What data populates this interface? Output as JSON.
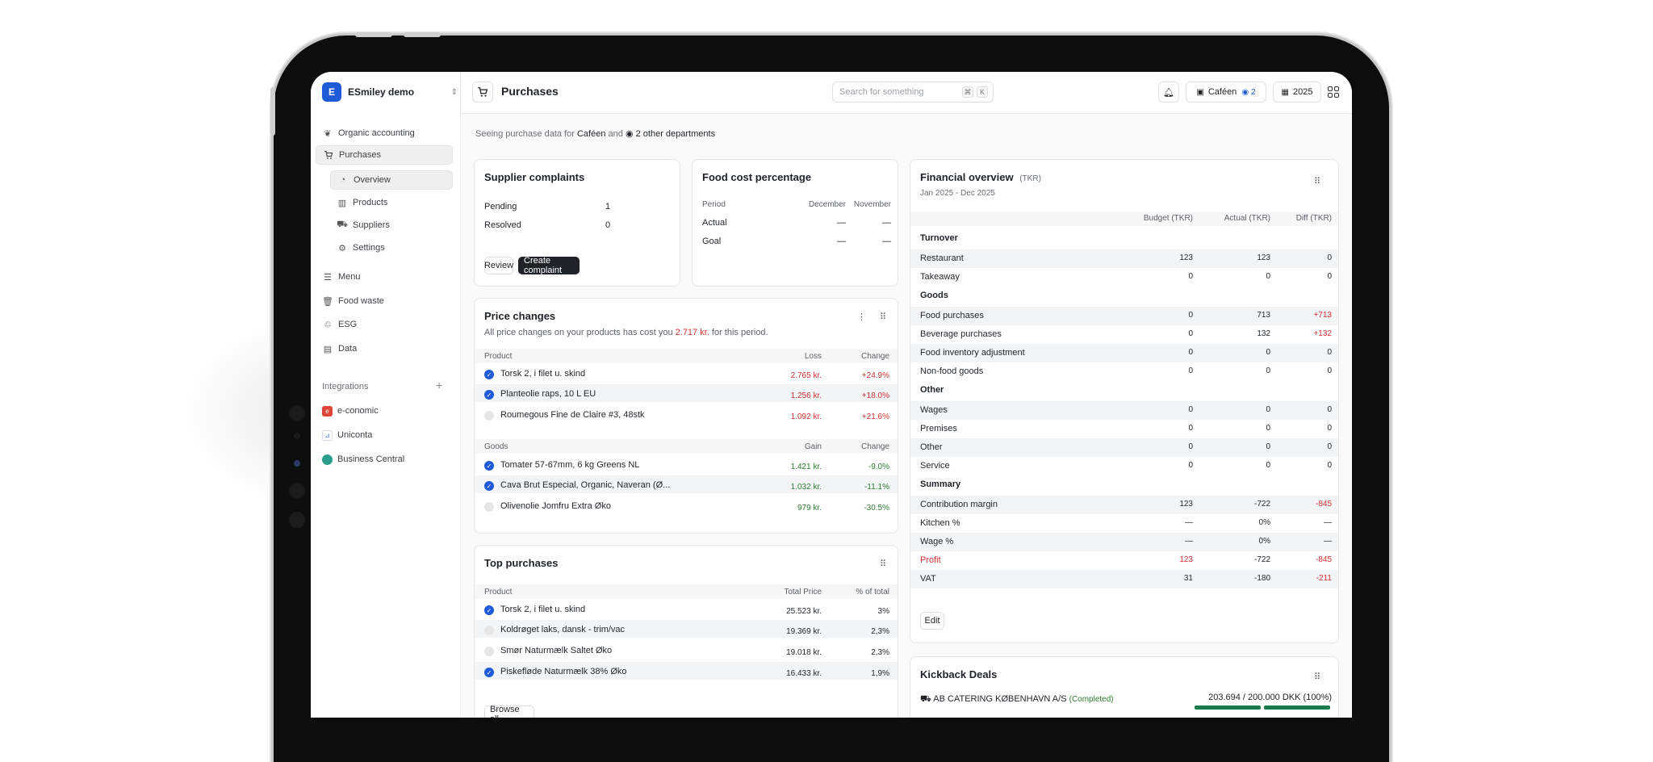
{
  "sidebar": {
    "org_initial": "E",
    "org_name": "ESmiley demo",
    "items": [
      {
        "label": "Organic accounting",
        "icon": "leaf-icon"
      },
      {
        "label": "Purchases",
        "icon": "cart-icon"
      },
      {
        "label": "Overview",
        "icon": "pie-icon"
      },
      {
        "label": "Products",
        "icon": "barcode-icon"
      },
      {
        "label": "Suppliers",
        "icon": "truck-icon"
      },
      {
        "label": "Settings",
        "icon": "gear-icon"
      },
      {
        "label": "Menu",
        "icon": "menu-icon"
      },
      {
        "label": "Food waste",
        "icon": "trash-icon"
      },
      {
        "label": "ESG",
        "icon": "recycle-icon"
      },
      {
        "label": "Data",
        "icon": "document-icon"
      }
    ],
    "integrations_label": "Integrations",
    "integrations": [
      {
        "label": "e-conomic",
        "color": "#e0453a"
      },
      {
        "label": "Uniconta",
        "color": "#3a7bd5"
      },
      {
        "label": "Business Central",
        "color": "#2a9d8f"
      }
    ]
  },
  "topbar": {
    "title": "Purchases",
    "search_placeholder": "Search for something",
    "kbd1": "⌘",
    "kbd2": "K",
    "department": "Caféen",
    "department_count": "2",
    "year": "2025"
  },
  "seeing": {
    "prefix": "Seeing purchase data for",
    "dept": "Caféen",
    "and": "and",
    "others": "2 other departments"
  },
  "complaints": {
    "title": "Supplier complaints",
    "rows": [
      {
        "label": "Pending",
        "value": "1"
      },
      {
        "label": "Resolved",
        "value": "0"
      }
    ],
    "review_label": "Review",
    "create_label": "Create complaint"
  },
  "foodcost": {
    "title": "Food cost percentage",
    "headers": [
      "Period",
      "December",
      "November"
    ],
    "rows": [
      {
        "label": "Actual",
        "dec": "—",
        "nov": "—"
      },
      {
        "label": "Goal",
        "dec": "—",
        "nov": "—"
      }
    ]
  },
  "price_changes": {
    "title": "Price changes",
    "desc_prefix": "All price changes on your products has cost you",
    "desc_amount": "2.717 kr.",
    "desc_suffix": "for this period.",
    "loss_headers": [
      "Product",
      "Loss",
      "Change"
    ],
    "loss_rows": [
      {
        "name": "Torsk 2, i filet u. skind",
        "value": "2.765 kr.",
        "change": "+24.9%",
        "checked": true
      },
      {
        "name": "Planteolie raps, 10 L EU",
        "value": "1.256 kr.",
        "change": "+18.0%",
        "checked": true
      },
      {
        "name": "Roumegous Fine de Claire #3, 48stk",
        "value": "1.092 kr.",
        "change": "+21.6%",
        "checked": false
      }
    ],
    "gain_headers": [
      "Goods",
      "Gain",
      "Change"
    ],
    "gain_rows": [
      {
        "name": "Tomater 57-67mm, 6 kg Greens NL",
        "value": "1.421 kr.",
        "change": "-9.0%",
        "checked": true
      },
      {
        "name": "Cava Brut Especial, Organic, Naveran (Ø...",
        "value": "1.032 kr.",
        "change": "-11.1%",
        "checked": true
      },
      {
        "name": "Olivenolie Jomfru Extra Øko",
        "value": "979 kr.",
        "change": "-30.5%",
        "checked": false
      }
    ]
  },
  "top_purchases": {
    "title": "Top purchases",
    "headers": [
      "Product",
      "Total Price",
      "% of total"
    ],
    "rows": [
      {
        "name": "Torsk 2, i filet u. skind",
        "price": "25.523 kr.",
        "pct": "3%",
        "checked": true
      },
      {
        "name": "Koldrøget laks, dansk - trim/vac",
        "price": "19.369 kr.",
        "pct": "2,3%",
        "checked": false
      },
      {
        "name": "Smør Naturmælk Saltet Øko",
        "price": "19.018 kr.",
        "pct": "2,3%",
        "checked": false
      },
      {
        "name": "Piskefløde Naturmælk 38% Øko",
        "price": "16.433 kr.",
        "pct": "1,9%",
        "checked": true
      }
    ],
    "browse_label": "Browse all"
  },
  "financial": {
    "title": "Financial overview",
    "unit": "(TKR)",
    "period": "Jan 2025 - Dec 2025",
    "headers": [
      "Budget (TKR)",
      "Actual (TKR)",
      "Diff (TKR)"
    ],
    "sections": [
      {
        "name": "Turnover",
        "rows": [
          {
            "label": "Restaurant",
            "budget": "123",
            "actual": "123",
            "diff": "0"
          },
          {
            "label": "Takeaway",
            "budget": "0",
            "actual": "0",
            "diff": "0"
          }
        ]
      },
      {
        "name": "Goods",
        "rows": [
          {
            "label": "Food purchases",
            "budget": "0",
            "actual": "713",
            "diff": "+713"
          },
          {
            "label": "Beverage purchases",
            "budget": "0",
            "actual": "132",
            "diff": "+132"
          },
          {
            "label": "Food inventory adjustment",
            "budget": "0",
            "actual": "0",
            "diff": "0"
          },
          {
            "label": "Non-food goods",
            "budget": "0",
            "actual": "0",
            "diff": "0"
          }
        ]
      },
      {
        "name": "Other",
        "rows": [
          {
            "label": "Wages",
            "budget": "0",
            "actual": "0",
            "diff": "0"
          },
          {
            "label": "Premises",
            "budget": "0",
            "actual": "0",
            "diff": "0"
          },
          {
            "label": "Other",
            "budget": "0",
            "actual": "0",
            "diff": "0"
          },
          {
            "label": "Service",
            "budget": "0",
            "actual": "0",
            "diff": "0"
          }
        ]
      },
      {
        "name": "Summary",
        "rows": [
          {
            "label": "Contribution margin",
            "budget": "123",
            "actual": "-722",
            "diff": "-845"
          },
          {
            "label": "Kitchen %",
            "budget": "—",
            "actual": "0%",
            "diff": "—"
          },
          {
            "label": "Wage %",
            "budget": "—",
            "actual": "0%",
            "diff": "—"
          },
          {
            "label": "Profit",
            "budget": "123",
            "actual": "-722",
            "diff": "-845"
          },
          {
            "label": "VAT",
            "budget": "31",
            "actual": "-180",
            "diff": "-211"
          }
        ]
      }
    ],
    "edit_label": "Edit"
  },
  "kickback": {
    "title": "Kickback Deals",
    "supplier": "AB CATERING KØBENHAVN A/S",
    "status": "(Completed)",
    "amount": "203.694 / 200.000 DKK (100%)",
    "progress": 1.0
  }
}
